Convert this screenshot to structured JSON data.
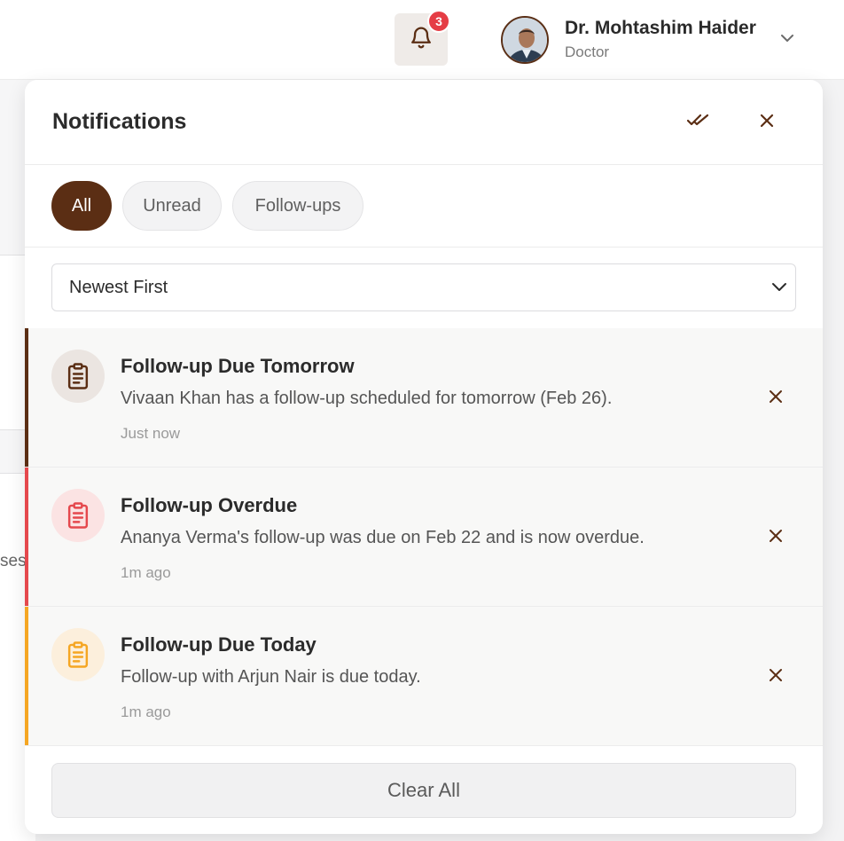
{
  "header": {
    "notification_count": "3",
    "user": {
      "name": "Dr. Mohtashim Haider",
      "role": "Doctor"
    }
  },
  "background": {
    "partial_text": "ses"
  },
  "panel": {
    "title": "Notifications",
    "filters": [
      {
        "label": "All",
        "active": true
      },
      {
        "label": "Unread",
        "active": false
      },
      {
        "label": "Follow-ups",
        "active": false
      }
    ],
    "sort": {
      "selected": "Newest First"
    },
    "notifications": [
      {
        "title": "Follow-up Due Tomorrow",
        "message": "Vivaan Khan has a follow-up scheduled for tomorrow (Feb 26).",
        "time": "Just now",
        "accent_color": "#5b2e14",
        "icon": "clipboard-icon"
      },
      {
        "title": "Follow-up Overdue",
        "message": "Ananya Verma's follow-up was due on Feb 22 and is now overdue.",
        "time": "1m ago",
        "accent_color": "#e5484d",
        "icon": "clipboard-icon"
      },
      {
        "title": "Follow-up Due Today",
        "message": "Follow-up with Arjun Nair is due today.",
        "time": "1m ago",
        "accent_color": "#f5a623",
        "icon": "clipboard-icon"
      }
    ],
    "clear_all_label": "Clear All"
  },
  "colors": {
    "brand": "#5b2e14",
    "badge": "#e53d45",
    "overdue": "#e5484d",
    "today": "#f5a623"
  }
}
